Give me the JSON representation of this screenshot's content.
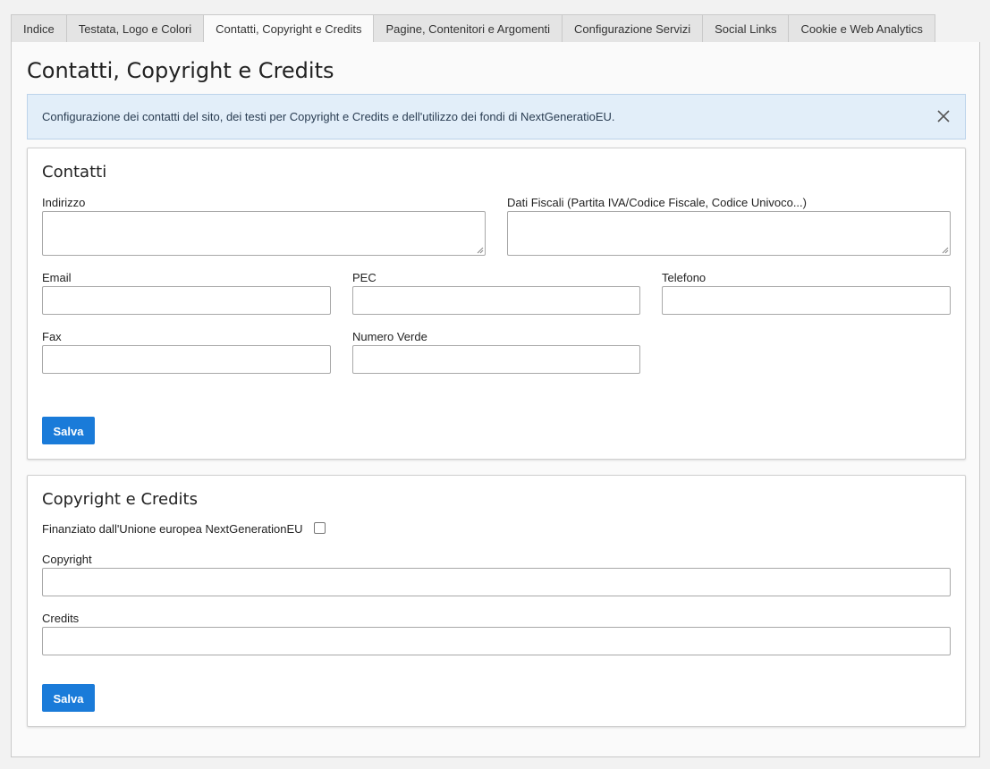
{
  "tabs": [
    {
      "label": "Indice"
    },
    {
      "label": "Testata, Logo e Colori"
    },
    {
      "label": "Contatti, Copyright e Credits"
    },
    {
      "label": "Pagine, Contenitori e Argomenti"
    },
    {
      "label": "Configurazione Servizi"
    },
    {
      "label": "Social Links"
    },
    {
      "label": "Cookie e Web Analytics"
    }
  ],
  "active_tab": "Contatti, Copyright e Credits",
  "page_title": "Contatti, Copyright e Credits",
  "notice": {
    "text": "Configurazione dei contatti del sito, dei testi per Copyright e Credits e dell'utilizzo dei fondi di NextGeneratioEU.",
    "close_icon": "close-icon"
  },
  "contacts": {
    "title": "Contatti",
    "address_label": "Indirizzo",
    "address_value": "",
    "fiscal_label": "Dati Fiscali (Partita IVA/Codice Fiscale, Codice Univoco...)",
    "fiscal_value": "",
    "email_label": "Email",
    "email_value": "",
    "pec_label": "PEC",
    "pec_value": "",
    "phone_label": "Telefono",
    "phone_value": "",
    "fax_label": "Fax",
    "fax_value": "",
    "tollfree_label": "Numero Verde",
    "tollfree_value": "",
    "save_label": "Salva"
  },
  "copyright": {
    "title": "Copyright e Credits",
    "eu_funded_label": "Finanziato dall'Unione europea NextGenerationEU",
    "eu_funded_checked": false,
    "copyright_label": "Copyright",
    "copyright_value": "",
    "credits_label": "Credits",
    "credits_value": "",
    "save_label": "Salva"
  },
  "colors": {
    "accent": "#1a7bd9",
    "notice_bg": "#e2eef9"
  }
}
